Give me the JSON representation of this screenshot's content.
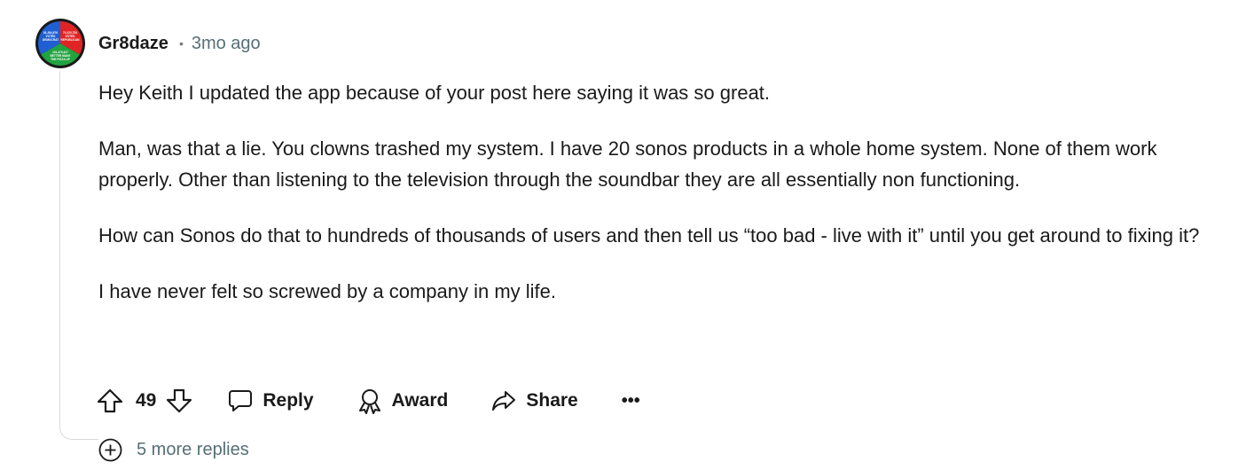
{
  "comment": {
    "author": "Gr8daze",
    "separator": "•",
    "time_ago": "3mo ago",
    "paragraphs": [
      "Hey Keith I updated the app because of your post here saying it was so great.",
      "Man, was that a lie. You clowns trashed my system. I have 20 sonos products in a whole home system. None of them work properly. Other than listening to the television through the soundbar they are all essentially non functioning.",
      "How can Sonos do that to hundreds of thousands of users and then tell us “too bad - live with it” until you get around to fixing it?",
      "I have never felt so screwed by a company in my life."
    ],
    "avatar": {
      "icon": "flair-avatar-icon",
      "colors": {
        "top_left": "#1f5fd1",
        "top_right": "#e02424",
        "bottom": "#21a33f",
        "rim": "#1a1a1b"
      },
      "labels": {
        "top_left": [
          "81,284,976",
          "VOTED",
          "DEMOCRAT"
        ],
        "top_right": [
          "74,223,753",
          "VOTED",
          "REPUBLICAN"
        ],
        "bottom": [
          "101,379,427",
          "BETTER MAKE",
          "THE PIZZA UP"
        ]
      }
    }
  },
  "actions": {
    "upvote_icon": "upvote-arrow-icon",
    "score": "49",
    "downvote_icon": "downvote-arrow-icon",
    "reply_label": "Reply",
    "award_label": "Award",
    "share_label": "Share",
    "more_label": "•••"
  },
  "more_replies": {
    "icon": "plus-circle-icon",
    "label": "5 more replies"
  }
}
